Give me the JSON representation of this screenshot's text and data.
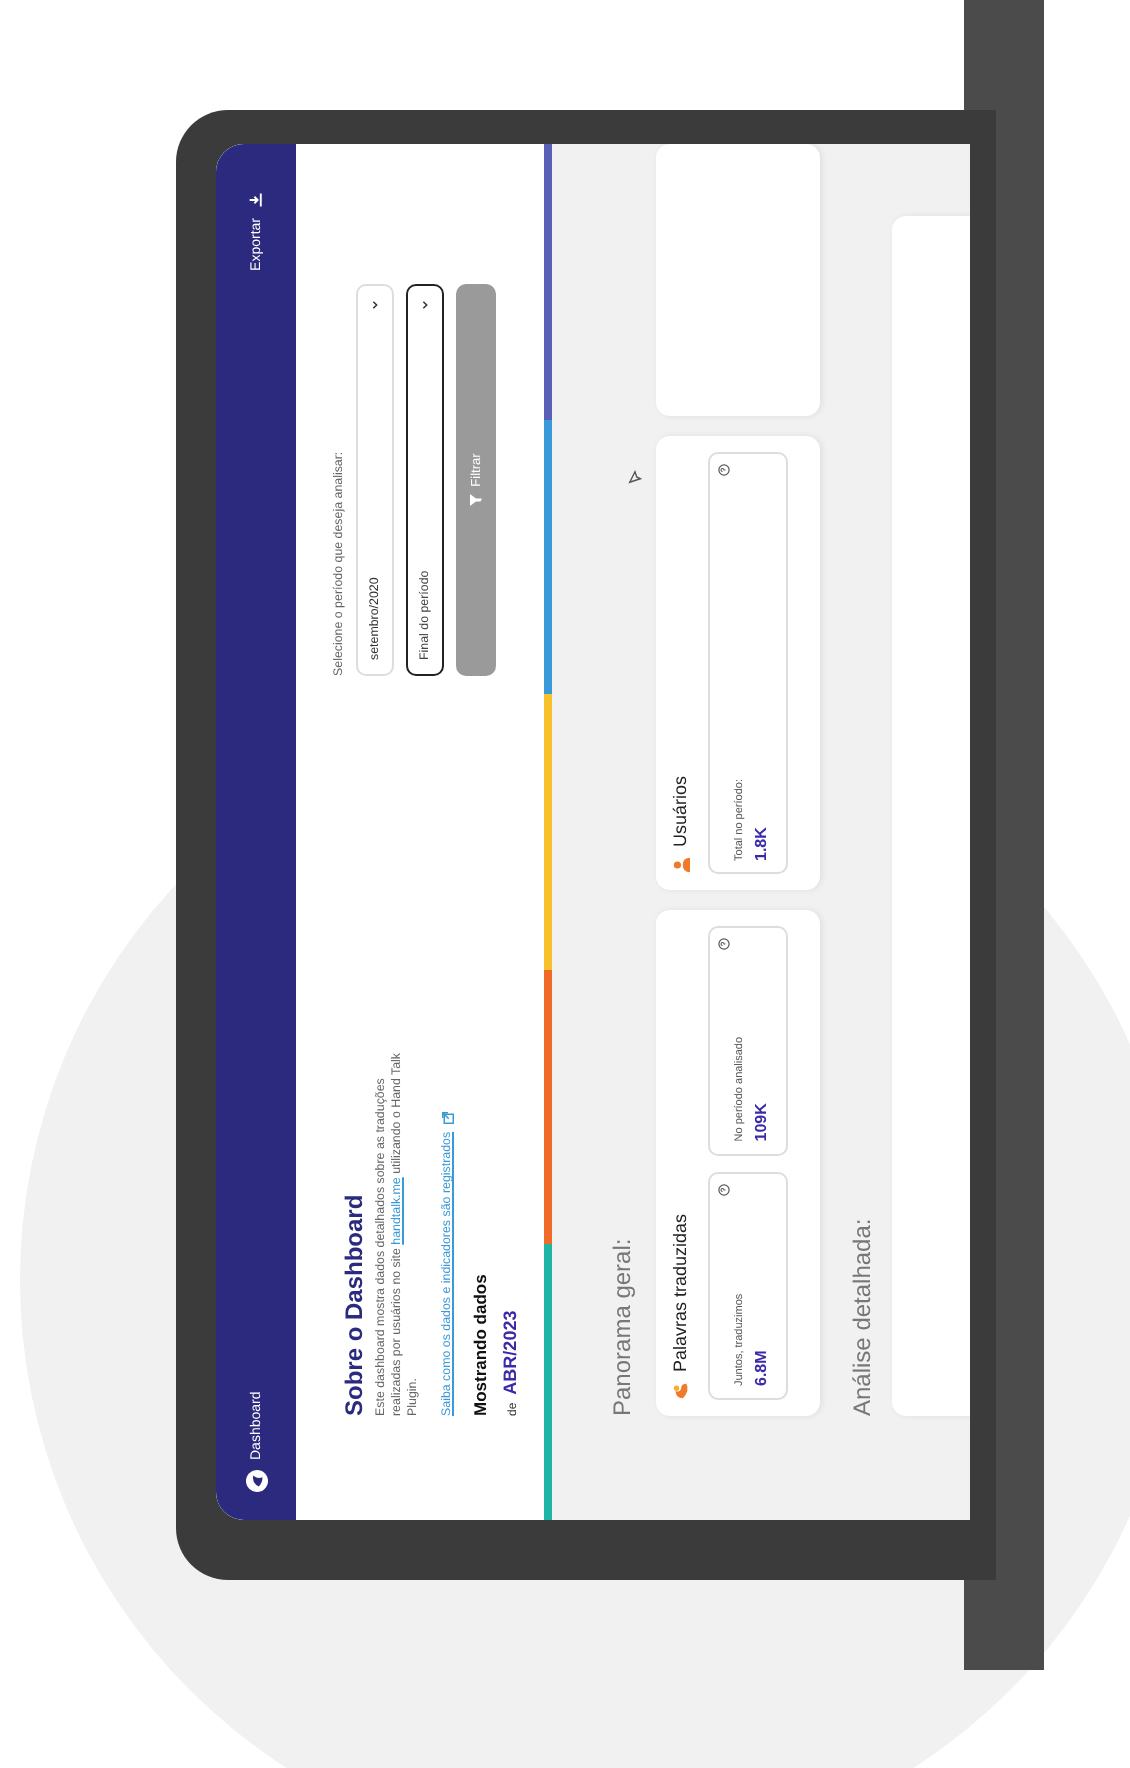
{
  "header": {
    "title": "Dashboard",
    "export_label": "Exportar"
  },
  "about": {
    "title": "Sobre o Dashboard",
    "description_before": "Este dashboard mostra dados detalhados sobre as traduções realizadas por usuários no site",
    "description_link": "handtalk.me",
    "description_after": "utilizando o Hand Talk Plugin.",
    "learn_more_link": "Saiba como os dados e indicadores são registrados",
    "showing_label": "Mostrando dados",
    "period_prefix": "de",
    "period": "ABR/2023"
  },
  "filter": {
    "prompt": "Selecione o período que deseja analisar:",
    "start": {
      "value": "setembro/2020",
      "focused": false
    },
    "end": {
      "placeholder": "Final do período",
      "focused": true
    },
    "button": {
      "label": "Filtrar",
      "disabled": true
    }
  },
  "stripe": [
    {
      "color": "#1fb5a5"
    },
    {
      "color": "#f06a2a"
    },
    {
      "color": "#f6c12b"
    },
    {
      "color": "#3a9ad9"
    },
    {
      "color": "#5b5fb5"
    }
  ],
  "overview": {
    "title": "Panorama geral:",
    "cards": [
      {
        "title": "Palavras traduzidas",
        "kind": "words",
        "metrics": [
          {
            "label": "Juntos, traduzimos",
            "value": "6.8M"
          },
          {
            "label": "No período analisado",
            "value": "109K"
          }
        ]
      },
      {
        "title": "Usuários",
        "kind": "users",
        "metrics": [
          {
            "label": "Total no período:",
            "value": "1.8K"
          }
        ]
      }
    ]
  },
  "details": {
    "title": "Análise detalhada:"
  }
}
